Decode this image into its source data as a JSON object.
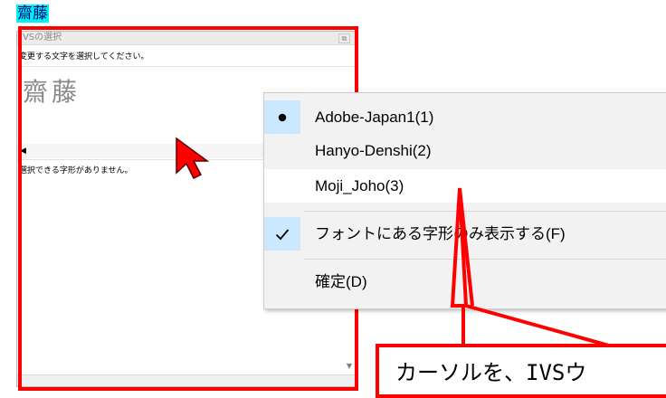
{
  "document": {
    "selected_text": "齋藤"
  },
  "ivs_window": {
    "title": "IVSの選択",
    "window_button": "⧉",
    "instruction": "変更する文字を選択してください。",
    "characters": "齋藤",
    "scroll_left_arrow": "◀",
    "status": "選択できる字形がありません。",
    "scroll_down_arrow": "▼"
  },
  "context_menu": {
    "items": [
      {
        "label": "Adobe-Japan1(1)",
        "mark": "bullet",
        "checked": true
      },
      {
        "label": "Hanyo-Denshi(2)",
        "mark": "none",
        "checked": false
      },
      {
        "label": "Moji_Joho(3)",
        "mark": "none",
        "checked": false
      },
      {
        "label": "フォントにある字形のみ表示する(F)",
        "mark": "checkmark",
        "checked": true
      },
      {
        "label": "確定(D)",
        "mark": "none",
        "checked": false
      }
    ]
  },
  "callout": {
    "text": "カーソルを、IVSウ"
  },
  "colors": {
    "highlight": "#ff0000",
    "selection_bg": "#00f2f2",
    "selection_text": "#000080",
    "menu_bg": "#f2f2f2",
    "check_bg": "#cce8ff",
    "cursor": "#ff0000"
  },
  "icons": {
    "bullet": "bullet-icon",
    "checkmark": "checkmark-icon",
    "cursor": "mouse-cursor-icon"
  }
}
